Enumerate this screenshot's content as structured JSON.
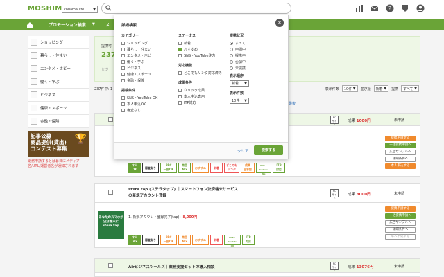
{
  "header": {
    "logo": "MOSHIMO",
    "site_select": "codama life",
    "icons": [
      "chart-icon",
      "mail-icon",
      "help-icon",
      "badge-icon",
      "user-icon"
    ]
  },
  "nav": {
    "items": [
      "プロモーション検索",
      "メ"
    ]
  },
  "sidebar": {
    "items": [
      "ショッピング",
      "暮らし・住まい",
      "エンタメ・ホビー",
      "働く・学ぶ",
      "ビジネス",
      "健康・スポーツ",
      "金融・保険"
    ],
    "banner": "記事公募\n商品提供(貸出)\nコンテスト募集",
    "note": "総務申請するとは暮日にメディア名/URL/運営者名が通知されます"
  },
  "info_box": {
    "label": "提携可",
    "number": "237",
    "sub": "セグ"
  },
  "sortbar": {
    "count": "237件中: 1",
    "per_page_label": "表示件数",
    "per_page": "10件",
    "sort_label": "並び順",
    "sort": "新着",
    "status_label": "提携",
    "status": "すべて",
    "pager": "最後"
  },
  "popup": {
    "title": "詳細検索",
    "category": {
      "heading": "カテゴリー",
      "options": [
        "ショッピング",
        "暮らし・住まい",
        "エンタメ・ホビー",
        "働く・学ぶ",
        "ビジネス",
        "健康・スポーツ",
        "金融・保険"
      ]
    },
    "posting": {
      "heading": "掲載条件",
      "options": [
        "SNS・YouTube OK",
        "本人申込OK",
        "審査なし"
      ]
    },
    "status": {
      "heading": "ステータス",
      "options": [
        "新着",
        "おすすめ",
        "SNS・YouTube注力"
      ],
      "checked": [
        false,
        true,
        false
      ]
    },
    "support": {
      "heading": "対応機能",
      "options": [
        "どこでもリンク対応済み"
      ]
    },
    "reward_cond": {
      "heading": "成果条件",
      "options": [
        "クリック成果",
        "本人申込専用",
        "ITP対応"
      ]
    },
    "partnership": {
      "heading": "提携状況",
      "options": [
        "すべて",
        "申請中",
        "提携中",
        "否認中",
        "未提携"
      ],
      "selected": 0
    },
    "order": {
      "heading": "表示順序",
      "value": "新着"
    },
    "count": {
      "heading": "表示件数",
      "value": "10件"
    },
    "clear": "クリア",
    "submit": "検索する"
  },
  "cards": [
    {
      "title": "",
      "pc_label": "PC\nサイト",
      "reward_prefix": "成果",
      "reward": "1000円",
      "status": "未申請",
      "buttons": [
        "提携申請する",
        "一括提携申請へ",
        "広告サンプルへ",
        "詳細条件へ",
        "本人申込する"
      ],
      "badges": [
        "本人\nOK",
        "審査有り",
        "PPC\n一部OK",
        "商品\nNG",
        "おすすめ",
        "新着",
        "どこでも\nリンク",
        "成果\n全承認",
        "SNS・YouTube\nNG",
        "ITP\n対応"
      ]
    },
    {
      "title": "stera tap (ステラタップ) ｜スマートフォン決済端末サービス\nの新規アカウント登録",
      "pc_label": "PC\nサイト",
      "reward_prefix": "成果",
      "reward": "8000円",
      "status": "未申請",
      "line": "1. 新規アカウント登録完了(tap)：",
      "line_value": "8,000円",
      "thumb_text": "あなたのスマホが\n決済端末に\nstera tap",
      "buttons": [
        "提携申請する",
        "一括提携申請へ",
        "広告サンプルへ",
        "詳細条件へ",
        "本人申込する"
      ],
      "badges": [
        "本人\nNG",
        "審査有り",
        "PPC\n一部OK",
        "商品\nNG",
        "おすすめ",
        "新着",
        "SNS・YouTube\nOK",
        "ITP\n対応"
      ]
    },
    {
      "title": "Airビジネスツールズ｜業務支援セットの導入相談",
      "pc_label": "PC\nサイト",
      "reward_prefix": "成果",
      "reward": "13076円",
      "status": "未申請"
    }
  ]
}
